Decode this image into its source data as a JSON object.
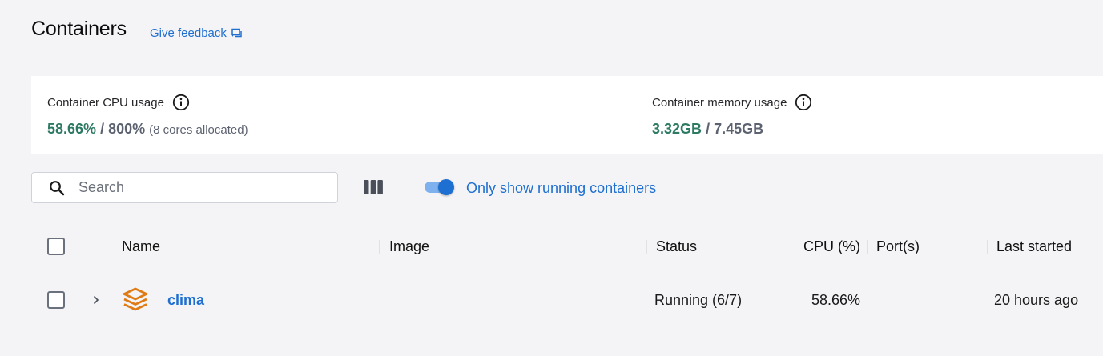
{
  "header": {
    "title": "Containers",
    "feedback_label": "Give feedback"
  },
  "stats": {
    "cpu": {
      "label": "Container CPU usage",
      "used": "58.66%",
      "separator": "/",
      "total": "800%",
      "note": "(8 cores allocated)"
    },
    "memory": {
      "label": "Container memory usage",
      "used": "3.32GB",
      "separator": "/",
      "total": "7.45GB"
    }
  },
  "toolbar": {
    "search_placeholder": "Search",
    "search_value": "",
    "toggle_label": "Only show running containers",
    "toggle_on": true
  },
  "table": {
    "columns": [
      "Name",
      "Image",
      "Status",
      "CPU (%)",
      "Port(s)",
      "Last started"
    ],
    "rows": [
      {
        "name": "clima",
        "image": "",
        "status": "Running (6/7)",
        "cpu": "58.66%",
        "ports": "",
        "last_started": "20 hours ago"
      }
    ]
  },
  "colors": {
    "accent": "#1f6fd1",
    "usage_green": "#2d7a63",
    "stack_orange": "#e07a12"
  },
  "icons": {
    "feedback": "feedback-icon",
    "info": "info-icon",
    "search": "search-icon",
    "columns": "columns-icon",
    "expand": "chevron-right-icon",
    "compose": "stack-layers-icon"
  }
}
